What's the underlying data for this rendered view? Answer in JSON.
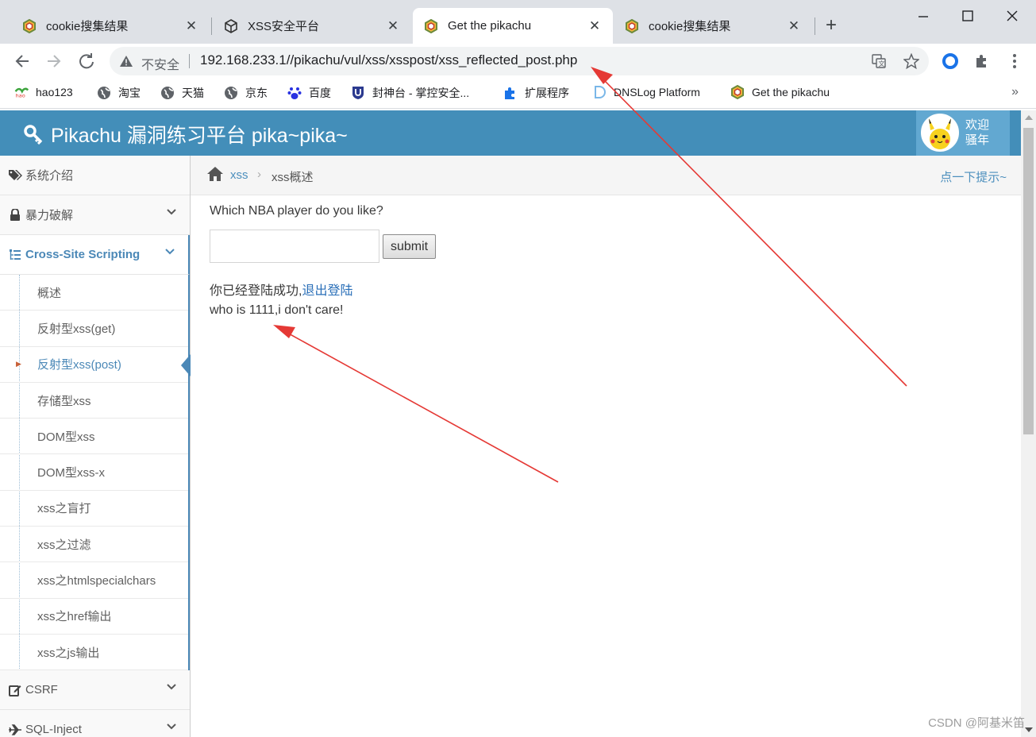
{
  "browser": {
    "tabs": [
      {
        "title": "cookie搜集结果",
        "active": false
      },
      {
        "title": "XSS安全平台",
        "active": false
      },
      {
        "title": "Get the pikachu",
        "active": true
      },
      {
        "title": "cookie搜集结果",
        "active": false
      }
    ],
    "close_glyph": "✕",
    "new_tab_glyph": "+",
    "address": {
      "security_label": "不安全",
      "url": "192.168.233.1//pikachu/vul/xss/xsspost/xss_reflected_post.php"
    },
    "bookmarks": [
      {
        "label": "hao123",
        "icon": "hao123-icon"
      },
      {
        "label": "淘宝",
        "icon": "globe-icon"
      },
      {
        "label": "天猫",
        "icon": "globe-icon"
      },
      {
        "label": "京东",
        "icon": "globe-icon"
      },
      {
        "label": "百度",
        "icon": "baidu-paw-icon"
      },
      {
        "label": "封神台 - 掌控安全...",
        "icon": "shield-icon"
      },
      {
        "label": "扩展程序",
        "icon": "puzzle-icon"
      },
      {
        "label": "DNSLog Platform",
        "icon": "dnslog-icon"
      },
      {
        "label": "Get the pikachu",
        "icon": "pikachu-logo-icon"
      }
    ],
    "bookmarks_overflow": "»",
    "colors": {
      "tabstrip": "#dee1e6",
      "omnibox": "#f1f3f4"
    }
  },
  "app": {
    "brand": "Pikachu 漏洞练习平台 pika~pika~",
    "welcome_line1": "欢迎",
    "welcome_line2": "骚年",
    "colors": {
      "header": "#438eb9",
      "accent": "#4b88b7"
    }
  },
  "sidebar": {
    "top_items": [
      {
        "label": "系统介绍",
        "icon": "tags-icon"
      },
      {
        "label": "暴力破解",
        "icon": "lock-icon"
      },
      {
        "label": "Cross-Site Scripting",
        "icon": "list-tree-icon"
      }
    ],
    "xss_items": [
      "概述",
      "反射型xss(get)",
      "反射型xss(post)",
      "存储型xss",
      "DOM型xss",
      "DOM型xss-x",
      "xss之盲打",
      "xss之过滤",
      "xss之htmlspecialchars",
      "xss之href输出",
      "xss之js输出"
    ],
    "active_item": "反射型xss(post)",
    "bottom_items": [
      {
        "label": "CSRF",
        "icon": "edit-icon"
      },
      {
        "label": "SQL-Inject",
        "icon": "plane-icon"
      }
    ]
  },
  "breadcrumbs": {
    "items": [
      "xss",
      "xss概述"
    ],
    "separator": "›",
    "hint": "点一下提示~"
  },
  "main": {
    "question": "Which NBA player do you like?",
    "input_value": "",
    "submit_label": "submit",
    "login_prefix": "你已经登陆成功,",
    "logout_link": "退出登陆",
    "result": "who is 1111,i don't care!"
  },
  "watermark": "CSDN @阿基米笛"
}
